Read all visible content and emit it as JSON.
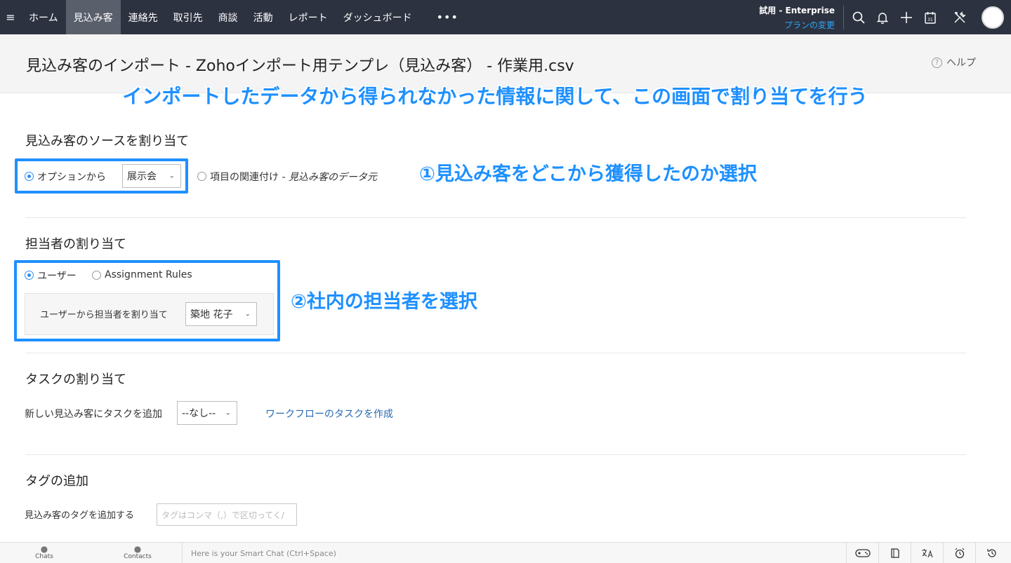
{
  "nav": {
    "menu_icon": "menu-icon",
    "items": [
      {
        "label": "ホーム",
        "active": false
      },
      {
        "label": "見込み客",
        "active": true
      },
      {
        "label": "連絡先",
        "active": false
      },
      {
        "label": "取引先",
        "active": false
      },
      {
        "label": "商談",
        "active": false
      },
      {
        "label": "活動",
        "active": false
      },
      {
        "label": "レポート",
        "active": false
      },
      {
        "label": "ダッシュボード",
        "active": false
      }
    ],
    "more": "•••",
    "plan_title": "試用 - Enterprise",
    "plan_link": "プランの変更",
    "icons": [
      "search-icon",
      "bell-icon",
      "plus-icon",
      "calendar-icon",
      "tools-icon"
    ],
    "calendar_day": "31"
  },
  "header": {
    "title": "見込み客のインポート - Zohoインポート用テンプレ（見込み客） - 作業用.csv",
    "help_label": "ヘルプ",
    "help_icon": "?"
  },
  "annotations": {
    "banner": "インポートしたデータから得られなかった情報に関して、この画面で割り当てを行う",
    "step1": "①見込み客をどこから獲得したのか選択",
    "step2": "②社内の担当者を選択",
    "highlight_color": "#1e90ff"
  },
  "source_section": {
    "title": "見込み客のソースを割り当て",
    "option_from_label": "オプションから",
    "option_from_selected": true,
    "source_value": "展示会",
    "option_map_label": "項目の関連付け - ",
    "option_map_italic": "見込み客のデータ元"
  },
  "owner_section": {
    "title": "担当者の割り当て",
    "user_label": "ユーザー",
    "rules_label": "Assignment Rules",
    "user_selected": true,
    "assign_label": "ユーザーから担当者を割り当て",
    "assignee_value": "築地 花子"
  },
  "task_section": {
    "title": "タスクの割り当て",
    "add_task_label": "新しい見込み客にタスクを追加",
    "task_value": "--なし--",
    "workflow_link": "ワークフローのタスクを作成"
  },
  "tag_section": {
    "title": "タグの追加",
    "add_tag_label": "見込み客のタグを追加する",
    "tag_placeholder": "タグはコンマ（,）で区切ってく/"
  },
  "bottombar": {
    "chats_label": "Chats",
    "contacts_label": "Contacts",
    "chat_placeholder": "Here is your Smart Chat (Ctrl+Space)",
    "tool_icons": [
      "gamepad-icon",
      "notes-icon",
      "translate-icon",
      "alarm-icon",
      "history-icon"
    ]
  }
}
